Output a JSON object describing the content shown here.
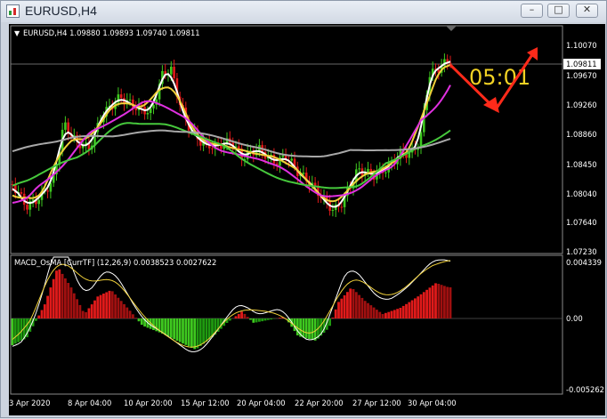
{
  "window": {
    "title": "EURUSD,H4",
    "minimize_glyph": "–",
    "maximize_glyph": "□",
    "close_glyph": "✕"
  },
  "price_panel": {
    "header_arrow": "▼",
    "header": "EURUSD,H4  1.09880 1.09893 1.09740 1.09811",
    "price_ticks": [
      "1.10070",
      "1.09670",
      "1.09260",
      "1.08860",
      "1.08450",
      "1.08040",
      "1.07640",
      "1.07230"
    ],
    "current_price": "1.09811",
    "countdown": "05:01"
  },
  "macd_panel": {
    "header": "MACD_OsMA [CurrTF] (12,26,9) 0.0038523 0.0027622",
    "value_ticks": [
      "0.004339",
      "0.00",
      "-0.005262"
    ]
  },
  "time_axis": {
    "labels": [
      "3 Apr 2020",
      "8 Apr 04:00",
      "10 Apr 20:00",
      "15 Apr 12:00",
      "20 Apr 04:00",
      "22 Apr 20:00",
      "27 Apr 12:00",
      "30 Apr 04:00"
    ]
  },
  "colors": {
    "background": "#000000",
    "bull_candle": "#3ec81f",
    "bear_candle": "#e01a1a",
    "countdown": "#f2d224",
    "arrow": "#ff2a1a",
    "ma_white": "#ffffff",
    "ma_yellow": "#f0d03a",
    "ma_magenta": "#e030e0",
    "ma_green": "#46c83c",
    "ma_gray": "#a8a8a8"
  }
}
